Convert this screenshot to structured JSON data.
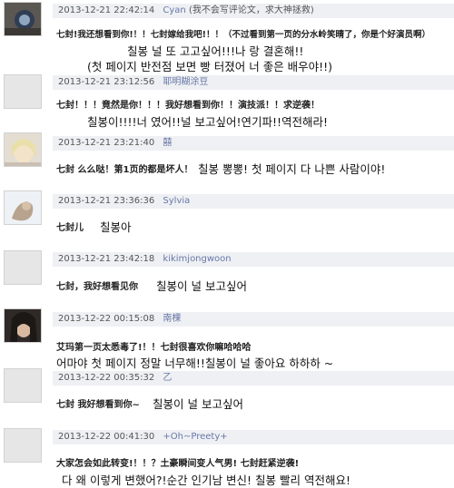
{
  "comments": [
    {
      "timestamp": "2013-12-21 22:42:14",
      "username": "Cyan",
      "note": "(我不会写评论文，求大神拯救)",
      "text_cn": "七封!我还想看到你!！！七封嫁给我吧!！！（不过看到第一页的分水岭笑晴了，你是个好演员啊）",
      "text_kr_1": "칠봉 널 또 고고싶어!!!나 랑 결혼해!!",
      "text_kr_2": "(첫 페이지 반전점 보면 빵 터졌어 너 좋은 배우야!!)"
    },
    {
      "timestamp": "2013-12-21 23:12:56",
      "username": "耶明糊涂豆",
      "text_cn": "七封！！！竟然是你！！！我好想看到你！！演技派！！求逆袭！",
      "text_kr_1": "칠봉이!!!!너 였어!!널 보고싶어!연기파!!역전해라!"
    },
    {
      "timestamp": "2013-12-21 23:21:40",
      "username": "囍",
      "text_cn": "七封 么么哒！第1页的都是坏人！",
      "text_kr_1": "칠봉 뽕뽕! 첫 페이지 다 나쁜 사람이야!"
    },
    {
      "timestamp": "2013-12-21 23:36:36",
      "username": "Sylvia",
      "text_cn": "七封儿",
      "text_kr_1": "칠봉아"
    },
    {
      "timestamp": "2013-12-21 23:42:18",
      "username": "kikimjongwoon",
      "text_cn": "七封，我好想看见你",
      "text_kr_1": "칠봉이 널 보고싶어"
    },
    {
      "timestamp": "2013-12-22 00:15:08",
      "username": "南棵",
      "text_cn": "艾玛第一页太悉毒了!！！七封很喜欢你嘛哈哈哈",
      "text_kr_1": "어마야 첫 페이지 정말 너무해!!칠봉이 널 좋아요 하하하 ~"
    },
    {
      "timestamp": "2013-12-22 00:35:32",
      "username": "乙",
      "text_cn": "七封 我好想看到你~",
      "text_kr_1": "칠봉이 널 보고싶어"
    },
    {
      "timestamp": "2013-12-22 00:41:30",
      "username": "+Oh~Preety+",
      "text_cn": "大家怎会如此转变!！！？土豪瞬间变人气男! 七封赶紧逆袭!",
      "text_kr_1": "다 왜 이렇게 변했어?!순간 인기남 변신! 칠봉 빨리 역전해요!"
    }
  ]
}
